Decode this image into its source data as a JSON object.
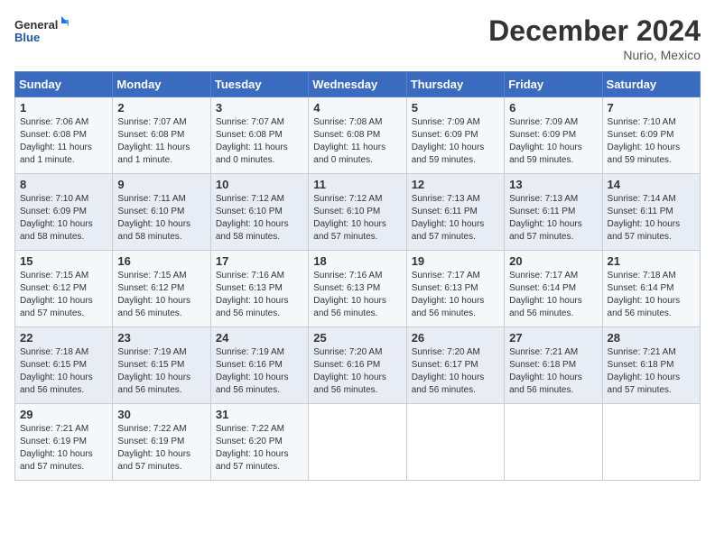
{
  "logo": {
    "line1": "General",
    "line2": "Blue"
  },
  "title": "December 2024",
  "location": "Nurio, Mexico",
  "days_of_week": [
    "Sunday",
    "Monday",
    "Tuesday",
    "Wednesday",
    "Thursday",
    "Friday",
    "Saturday"
  ],
  "weeks": [
    [
      {
        "day": "1",
        "info": "Sunrise: 7:06 AM\nSunset: 6:08 PM\nDaylight: 11 hours\nand 1 minute."
      },
      {
        "day": "2",
        "info": "Sunrise: 7:07 AM\nSunset: 6:08 PM\nDaylight: 11 hours\nand 1 minute."
      },
      {
        "day": "3",
        "info": "Sunrise: 7:07 AM\nSunset: 6:08 PM\nDaylight: 11 hours\nand 0 minutes."
      },
      {
        "day": "4",
        "info": "Sunrise: 7:08 AM\nSunset: 6:08 PM\nDaylight: 11 hours\nand 0 minutes."
      },
      {
        "day": "5",
        "info": "Sunrise: 7:09 AM\nSunset: 6:09 PM\nDaylight: 10 hours\nand 59 minutes."
      },
      {
        "day": "6",
        "info": "Sunrise: 7:09 AM\nSunset: 6:09 PM\nDaylight: 10 hours\nand 59 minutes."
      },
      {
        "day": "7",
        "info": "Sunrise: 7:10 AM\nSunset: 6:09 PM\nDaylight: 10 hours\nand 59 minutes."
      }
    ],
    [
      {
        "day": "8",
        "info": "Sunrise: 7:10 AM\nSunset: 6:09 PM\nDaylight: 10 hours\nand 58 minutes."
      },
      {
        "day": "9",
        "info": "Sunrise: 7:11 AM\nSunset: 6:10 PM\nDaylight: 10 hours\nand 58 minutes."
      },
      {
        "day": "10",
        "info": "Sunrise: 7:12 AM\nSunset: 6:10 PM\nDaylight: 10 hours\nand 58 minutes."
      },
      {
        "day": "11",
        "info": "Sunrise: 7:12 AM\nSunset: 6:10 PM\nDaylight: 10 hours\nand 57 minutes."
      },
      {
        "day": "12",
        "info": "Sunrise: 7:13 AM\nSunset: 6:11 PM\nDaylight: 10 hours\nand 57 minutes."
      },
      {
        "day": "13",
        "info": "Sunrise: 7:13 AM\nSunset: 6:11 PM\nDaylight: 10 hours\nand 57 minutes."
      },
      {
        "day": "14",
        "info": "Sunrise: 7:14 AM\nSunset: 6:11 PM\nDaylight: 10 hours\nand 57 minutes."
      }
    ],
    [
      {
        "day": "15",
        "info": "Sunrise: 7:15 AM\nSunset: 6:12 PM\nDaylight: 10 hours\nand 57 minutes."
      },
      {
        "day": "16",
        "info": "Sunrise: 7:15 AM\nSunset: 6:12 PM\nDaylight: 10 hours\nand 56 minutes."
      },
      {
        "day": "17",
        "info": "Sunrise: 7:16 AM\nSunset: 6:13 PM\nDaylight: 10 hours\nand 56 minutes."
      },
      {
        "day": "18",
        "info": "Sunrise: 7:16 AM\nSunset: 6:13 PM\nDaylight: 10 hours\nand 56 minutes."
      },
      {
        "day": "19",
        "info": "Sunrise: 7:17 AM\nSunset: 6:13 PM\nDaylight: 10 hours\nand 56 minutes."
      },
      {
        "day": "20",
        "info": "Sunrise: 7:17 AM\nSunset: 6:14 PM\nDaylight: 10 hours\nand 56 minutes."
      },
      {
        "day": "21",
        "info": "Sunrise: 7:18 AM\nSunset: 6:14 PM\nDaylight: 10 hours\nand 56 minutes."
      }
    ],
    [
      {
        "day": "22",
        "info": "Sunrise: 7:18 AM\nSunset: 6:15 PM\nDaylight: 10 hours\nand 56 minutes."
      },
      {
        "day": "23",
        "info": "Sunrise: 7:19 AM\nSunset: 6:15 PM\nDaylight: 10 hours\nand 56 minutes."
      },
      {
        "day": "24",
        "info": "Sunrise: 7:19 AM\nSunset: 6:16 PM\nDaylight: 10 hours\nand 56 minutes."
      },
      {
        "day": "25",
        "info": "Sunrise: 7:20 AM\nSunset: 6:16 PM\nDaylight: 10 hours\nand 56 minutes."
      },
      {
        "day": "26",
        "info": "Sunrise: 7:20 AM\nSunset: 6:17 PM\nDaylight: 10 hours\nand 56 minutes."
      },
      {
        "day": "27",
        "info": "Sunrise: 7:21 AM\nSunset: 6:18 PM\nDaylight: 10 hours\nand 56 minutes."
      },
      {
        "day": "28",
        "info": "Sunrise: 7:21 AM\nSunset: 6:18 PM\nDaylight: 10 hours\nand 57 minutes."
      }
    ],
    [
      {
        "day": "29",
        "info": "Sunrise: 7:21 AM\nSunset: 6:19 PM\nDaylight: 10 hours\nand 57 minutes."
      },
      {
        "day": "30",
        "info": "Sunrise: 7:22 AM\nSunset: 6:19 PM\nDaylight: 10 hours\nand 57 minutes."
      },
      {
        "day": "31",
        "info": "Sunrise: 7:22 AM\nSunset: 6:20 PM\nDaylight: 10 hours\nand 57 minutes."
      },
      {
        "day": "",
        "info": ""
      },
      {
        "day": "",
        "info": ""
      },
      {
        "day": "",
        "info": ""
      },
      {
        "day": "",
        "info": ""
      }
    ]
  ]
}
